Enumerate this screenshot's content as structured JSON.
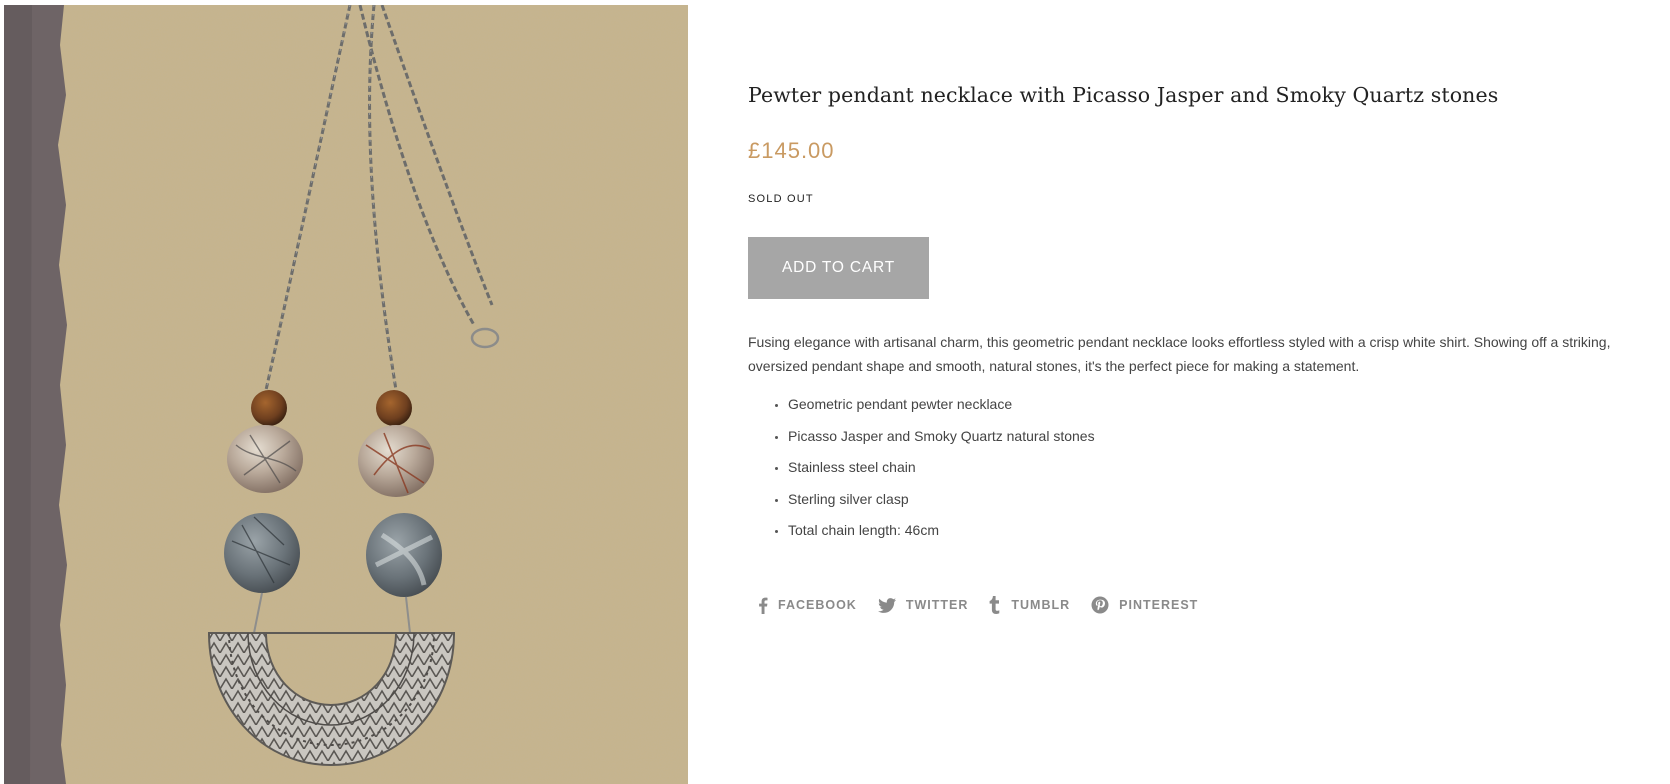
{
  "product": {
    "image_alt": "Pewter pendant necklace laid on textured brown paper",
    "title": "Pewter pendant necklace with Picasso Jasper and Smoky Quartz stones",
    "price": "£145.00",
    "stock_status": "SOLD OUT",
    "add_to_cart_label": "ADD TO CART",
    "description": "Fusing elegance with artisanal charm, this geometric pendant necklace looks effortless styled with a crisp white shirt. Showing off a striking, oversized pendant shape and smooth, natural stones, it's the perfect piece for making a statement.",
    "features": [
      "Geometric pendant pewter necklace",
      "Picasso Jasper and Smoky Quartz natural stones",
      "Stainless steel chain",
      "Sterling silver clasp",
      "Total chain length: 46cm"
    ]
  },
  "share": [
    {
      "label": "FACEBOOK",
      "icon": "facebook-icon"
    },
    {
      "label": "TWITTER",
      "icon": "twitter-icon"
    },
    {
      "label": "TUMBLR",
      "icon": "tumblr-icon"
    },
    {
      "label": "PINTEREST",
      "icon": "pinterest-icon"
    }
  ],
  "colors": {
    "price": "#c99a62",
    "button_bg": "#a6a6a6",
    "share_text": "#8a8a8a"
  }
}
